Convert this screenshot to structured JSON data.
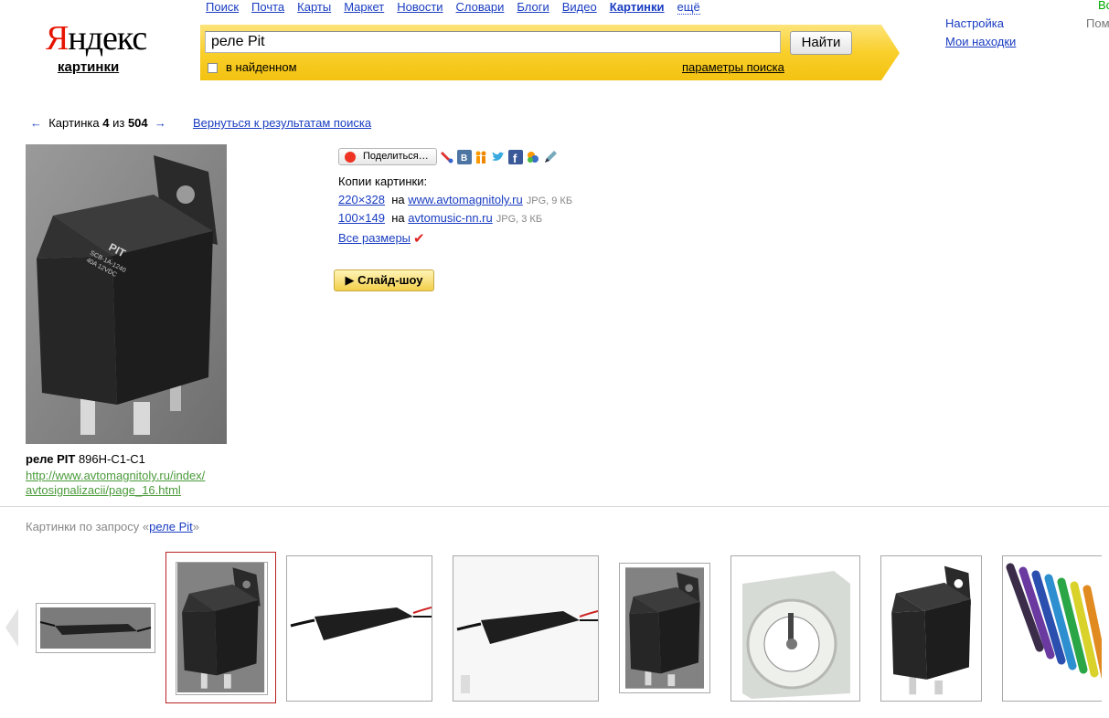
{
  "logo": {
    "first": "Я",
    "rest": "ндекс",
    "sub": "картинки"
  },
  "services": [
    {
      "label": "Поиск",
      "current": false
    },
    {
      "label": "Почта",
      "current": false
    },
    {
      "label": "Карты",
      "current": false
    },
    {
      "label": "Маркет",
      "current": false
    },
    {
      "label": "Новости",
      "current": false
    },
    {
      "label": "Словари",
      "current": false
    },
    {
      "label": "Блоги",
      "current": false
    },
    {
      "label": "Видео",
      "current": false
    },
    {
      "label": "Картинки",
      "current": true
    },
    {
      "label": "ещё",
      "current": false
    }
  ],
  "search": {
    "value": "реле Pit",
    "button": "Найти",
    "in_found": "в найденном",
    "params": "параметры поиска"
  },
  "header_right": {
    "settings": "Настройка",
    "my_finds": "Мои находки",
    "help": "Помо",
    "corner": "Во"
  },
  "pager": {
    "prev": "←",
    "label": "Картинка",
    "index": "4",
    "of": "из",
    "total": "504",
    "next": "→",
    "back": "Вернуться к результатам поиска"
  },
  "image": {
    "title_bold": "реле PIT",
    "title_rest": " 896H-C1-C1",
    "source_line1": "http://www.avtomagnitoly.ru/index/",
    "source_line2": "avtosignalizacii/page_16.html"
  },
  "share": {
    "button": "Поделиться…",
    "icons": [
      "livejournal-icon",
      "vkontakte-icon",
      "odnoklassniki-icon",
      "twitter-icon",
      "facebook-icon",
      "moimir-icon",
      "blog-pen-icon"
    ]
  },
  "copies": {
    "title": "Копии картинки:",
    "items": [
      {
        "size": "220×328",
        "on": "на",
        "site": "www.avtomagnitoly.ru",
        "meta": "JPG, 9 КБ"
      },
      {
        "size": "100×149",
        "on": "на",
        "site": "avtomusic-nn.ru",
        "meta": "JPG, 3 КБ"
      }
    ],
    "all_sizes": "Все размеры"
  },
  "slideshow": "▶ Слайд-шоу",
  "related": {
    "prefix": "Картинки по запросу «",
    "query": "реле Pit",
    "suffix": "»"
  },
  "colors": {
    "accent_yellow": "#f9cf2a",
    "link": "#1a3dc1",
    "logo_red": "#e61400",
    "source_green": "#4a9a3a"
  }
}
